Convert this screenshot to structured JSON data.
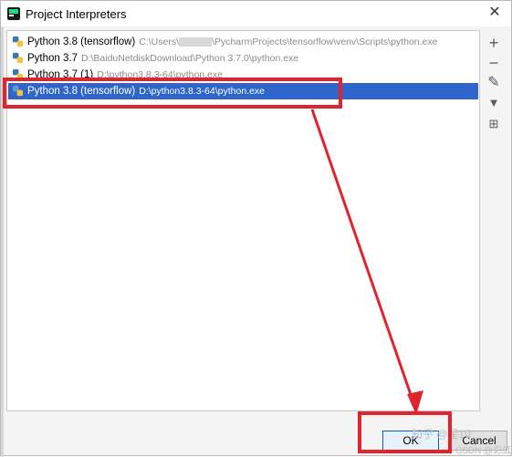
{
  "dialog": {
    "title": "Project Interpreters",
    "close_icon": "close-icon"
  },
  "interpreters": [
    {
      "name": "Python 3.8 (tensorflow)",
      "path_pre": "C:\\Users\\",
      "path_post": "\\PycharmProjects\\tensorflow\\venv\\Scripts\\python.exe",
      "selected": false
    },
    {
      "name": "Python 3.7",
      "path": "D:\\BaiduNetdiskDownload\\Python 3.7.0\\python.exe",
      "selected": false
    },
    {
      "name": "Python 3.7 (1)",
      "path": "D:\\python3.8.3-64\\python.exe",
      "selected": false
    },
    {
      "name": "Python 3.8 (tensorflow)",
      "path": "D:\\python3.8.3-64\\python.exe",
      "selected": true
    }
  ],
  "toolbar": {
    "add": "+",
    "remove": "−",
    "edit": "✎",
    "filter": "▼",
    "tree": "⊞"
  },
  "buttons": {
    "ok": "OK",
    "cancel": "Cancel"
  },
  "watermark": {
    "zhihu": "知乎 @星10",
    "csdn": "CSDN @彩虹"
  },
  "colors": {
    "selection": "#2f65ca",
    "annotation": "#e0232c"
  }
}
